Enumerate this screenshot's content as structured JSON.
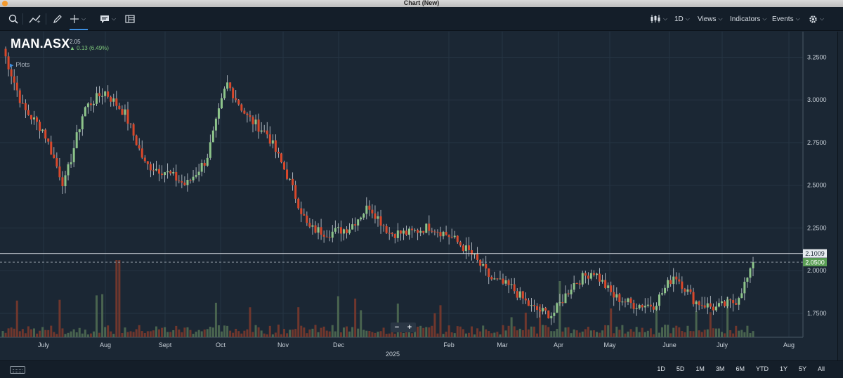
{
  "window": {
    "title": "Chart (New)"
  },
  "toolbar": {
    "interval": "1D",
    "views": "Views",
    "indicators": "Indicators",
    "events": "Events"
  },
  "instrument": {
    "symbol": "MAN.ASX",
    "last": "2.05",
    "change": "0.13 (6.49%)",
    "plots_label": "Plots"
  },
  "price_axis": {
    "ticks": [
      "3.2500",
      "3.0000",
      "2.7500",
      "2.5000",
      "2.2500",
      "2.0000",
      "1.7500"
    ],
    "tick_values": [
      3.25,
      3.0,
      2.75,
      2.5,
      2.25,
      2.0,
      1.75
    ],
    "range": [
      1.61,
      3.4
    ]
  },
  "time_axis": {
    "labels": [
      "July",
      "Aug",
      "Sept",
      "Oct",
      "Nov",
      "Dec",
      "Feb",
      "Mar",
      "Apr",
      "May",
      "June",
      "July",
      "Aug"
    ],
    "year_label": "2025"
  },
  "price_markers": {
    "horizontal_line_value": 2.1009,
    "horizontal_line_label": "2.1009",
    "last_price_value": 2.05,
    "last_price_label": "2.0500"
  },
  "zoom": {
    "minus": "−",
    "plus": "+"
  },
  "range_buttons": [
    "1D",
    "5D",
    "1M",
    "3M",
    "6M",
    "YTD",
    "1Y",
    "5Y",
    "All"
  ],
  "colors": {
    "up": "#8dc48a",
    "down": "#d9482b",
    "background": "#1b2734",
    "grid": "#263443",
    "accent": "#3d8fe0",
    "last_price_badge": "#5a9e55"
  },
  "chart_data": {
    "type": "candlestick",
    "series": [
      {
        "name": "MAN.ASX",
        "segments": [
          [
            3.3,
            2.95
          ],
          [
            2.95,
            2.82
          ],
          [
            2.82,
            2.5
          ],
          [
            2.5,
            2.95
          ],
          [
            2.95,
            3.05
          ],
          [
            3.05,
            2.92
          ],
          [
            2.92,
            2.62
          ],
          [
            2.62,
            2.58
          ],
          [
            2.58,
            2.5
          ],
          [
            2.5,
            2.65
          ],
          [
            2.65,
            3.1
          ],
          [
            3.1,
            2.9
          ],
          [
            2.9,
            2.8
          ],
          [
            2.8,
            2.55
          ],
          [
            2.55,
            2.25
          ],
          [
            2.25,
            2.22
          ],
          [
            2.22,
            2.25
          ],
          [
            2.25,
            2.38
          ],
          [
            2.38,
            2.22
          ],
          [
            2.22,
            2.22
          ],
          [
            2.22,
            2.26
          ],
          [
            2.26,
            2.2
          ],
          [
            2.2,
            2.1
          ],
          [
            2.1,
            1.95
          ],
          [
            1.95,
            1.9
          ],
          [
            1.9,
            1.78
          ],
          [
            1.78,
            1.74
          ],
          [
            1.74,
            1.92
          ],
          [
            1.92,
            2.0
          ],
          [
            2.0,
            1.85
          ],
          [
            1.85,
            1.8
          ],
          [
            1.8,
            1.8
          ],
          [
            1.8,
            1.98
          ],
          [
            1.98,
            1.82
          ],
          [
            1.82,
            1.78
          ],
          [
            1.78,
            1.82
          ],
          [
            1.82,
            2.05
          ]
        ]
      }
    ],
    "candle_count": 265
  }
}
